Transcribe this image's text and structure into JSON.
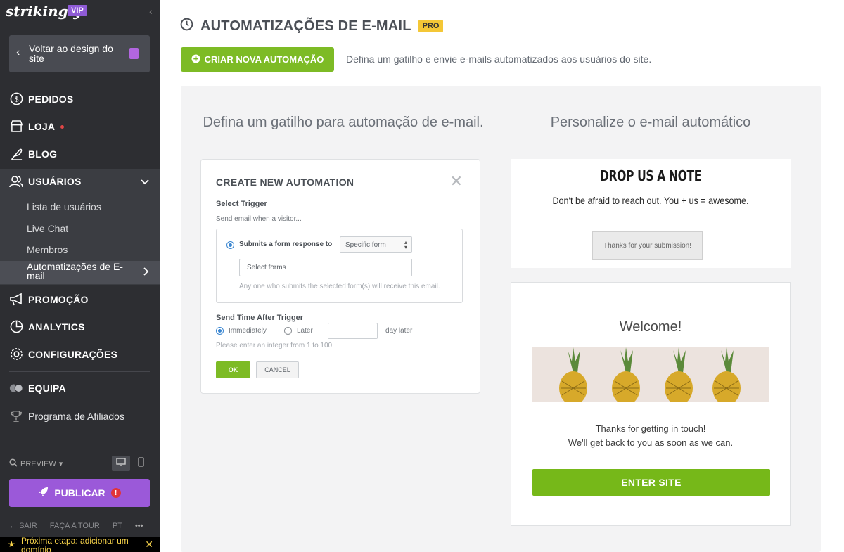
{
  "sidebar": {
    "logo": "strikingly",
    "vip_badge": "VIP",
    "back_label": "Voltar ao design do site",
    "nav": {
      "orders": "PEDIDOS",
      "store": "LOJA",
      "blog": "BLOG",
      "users": "USUÁRIOS",
      "promotion": "PROMOÇÃO",
      "analytics": "ANALYTICS",
      "settings": "CONFIGURAÇÕES",
      "team": "EQUIPA",
      "affiliates": "Programa de Afiliados"
    },
    "users_sub": {
      "list": "Lista de usuários",
      "chat": "Live Chat",
      "members": "Membros",
      "automations": "Automatizações de E-mail"
    },
    "preview_label": "PREVIEW",
    "publish_label": "PUBLICAR",
    "bottom": {
      "exit": "SAIR",
      "tour": "FAÇA A TOUR",
      "lang": "PT",
      "more": "•••"
    },
    "next_step": "Próxima etapa: adicionar um domínio"
  },
  "main": {
    "title": "AUTOMATIZAÇÕES DE E-MAIL",
    "pro_badge": "PRO",
    "create_button": "CRIAR NOVA AUTOMAÇÃO",
    "create_desc": "Defina um gatilho e envie e-mails automatizados aos usuários do site.",
    "left_heading": "Defina um gatilho para automação de e-mail.",
    "right_heading": "Personalize o e-mail automático"
  },
  "modal": {
    "title": "CREATE NEW AUTOMATION",
    "select_trigger": "Select Trigger",
    "send_when": "Send email when a visitor...",
    "submits_label": "Submits a form response to",
    "specific_form": "Specific form",
    "select_forms_placeholder": "Select forms",
    "submit_hint": "Any one who submits the selected form(s) will receive this email.",
    "send_time_label": "Send Time After Trigger",
    "immediately": "Immediately",
    "later": "Later",
    "day_later": "day later",
    "day_value": "",
    "integer_hint": "Please enter an integer  from 1 to 100.",
    "ok": "OK",
    "cancel": "CANCEL"
  },
  "preview_cards": {
    "note_title": "DROP US A NOTE",
    "note_sub": "Don't be afraid to reach out. You + us = awesome.",
    "thanks_button": "Thanks for your submission!",
    "welcome": "Welcome!",
    "message_line1": "Thanks for getting in touch!",
    "message_line2": "We'll get back to you as soon as we can.",
    "enter_button": "ENTER SITE"
  },
  "colors": {
    "accent_green": "#7dbb25",
    "purple": "#9b59d9",
    "sidebar": "#2d2e32",
    "pro": "#f4c736"
  }
}
